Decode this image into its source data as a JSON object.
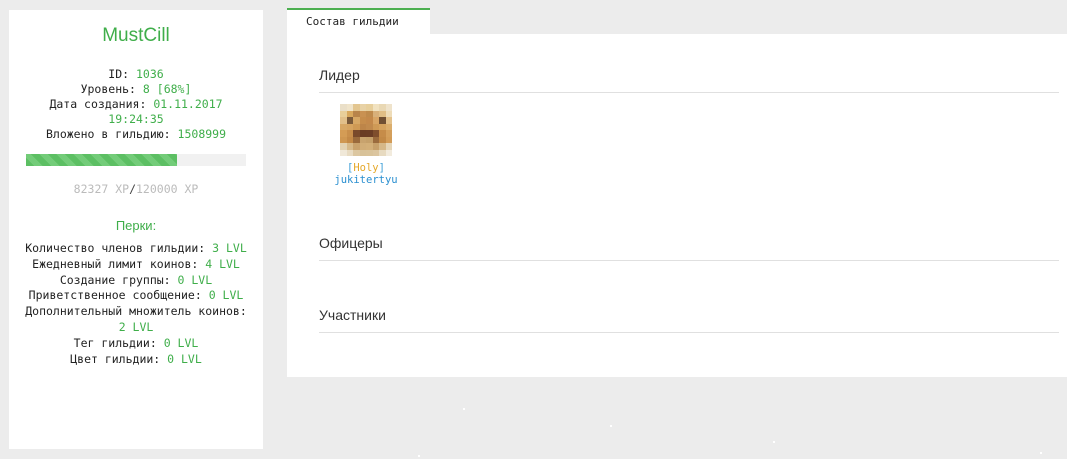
{
  "guild": {
    "name": "MustCill",
    "id_label": "ID:",
    "id_value": "1036",
    "level_label": "Уровень:",
    "level_value": "8",
    "level_percent": "[68%]",
    "created_label": "Дата создания:",
    "created_date": "01.11.2017",
    "created_time": "19:24:35",
    "invested_label": "Вложено в гильдию:",
    "invested_value": "1508999"
  },
  "xp": {
    "current": "82327 XP",
    "separator": "/",
    "max": "120000 XP",
    "progress": 0.686
  },
  "perks": {
    "title": "Перки:",
    "items": [
      {
        "label": "Количество членов гильдии:",
        "value": "3 LVL"
      },
      {
        "label": "Ежедневный лимит коинов:",
        "value": "4 LVL"
      },
      {
        "label": "Создание группы:",
        "value": "0 LVL"
      },
      {
        "label": "Приветственное сообщение:",
        "value": "0 LVL"
      },
      {
        "label": "Дополнительный множитель коинов:",
        "value": "2 LVL"
      },
      {
        "label": "Тег гильдии:",
        "value": "0 LVL"
      },
      {
        "label": "Цвет гильдии:",
        "value": "0 LVL"
      }
    ]
  },
  "tab": {
    "label": "Состав гильдии"
  },
  "sections": {
    "leader": "Лидер",
    "officers": "Офицеры",
    "members": "Участники"
  },
  "leader_member": {
    "tag_open": "[",
    "tag": "Holy",
    "tag_close": "]",
    "nick": "jukitertyu"
  },
  "colors": {
    "accent": "#3fae4a",
    "tag": "#e5a82a",
    "nick": "#2a8fd0"
  }
}
